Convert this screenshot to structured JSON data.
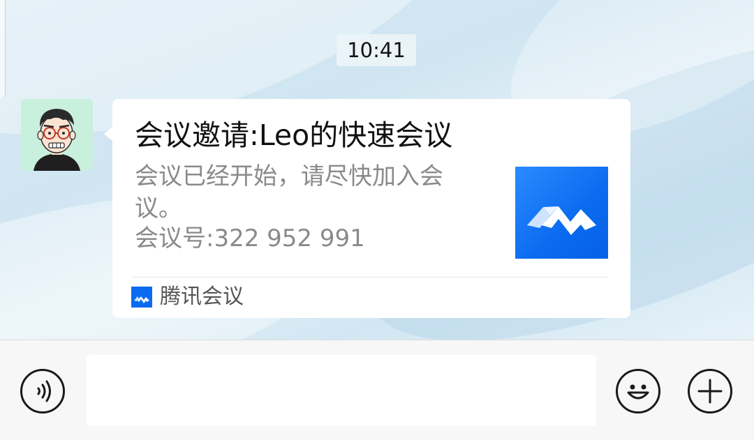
{
  "chat": {
    "timestamp": "10:41"
  },
  "message": {
    "sender_avatar": "cartoon-avatar-with-glasses",
    "card": {
      "title": "会议邀请:Leo的快速会议",
      "description": "会议已经开始，请尽快加入会议。",
      "meeting_id_line": "会议号:322 952 991",
      "thumbnail_icon": "tencent-meeting-logo",
      "source_icon": "tencent-meeting-logo",
      "source_name": "腾讯会议"
    }
  },
  "input_bar": {
    "voice_icon": "voice-icon",
    "text_value": "",
    "emoji_icon": "emoji-icon",
    "plus_icon": "plus-icon"
  },
  "colors": {
    "brand_blue": "#0a6bf0",
    "bubble_bg": "#ffffff",
    "secondary_text": "#8a8a8a"
  }
}
